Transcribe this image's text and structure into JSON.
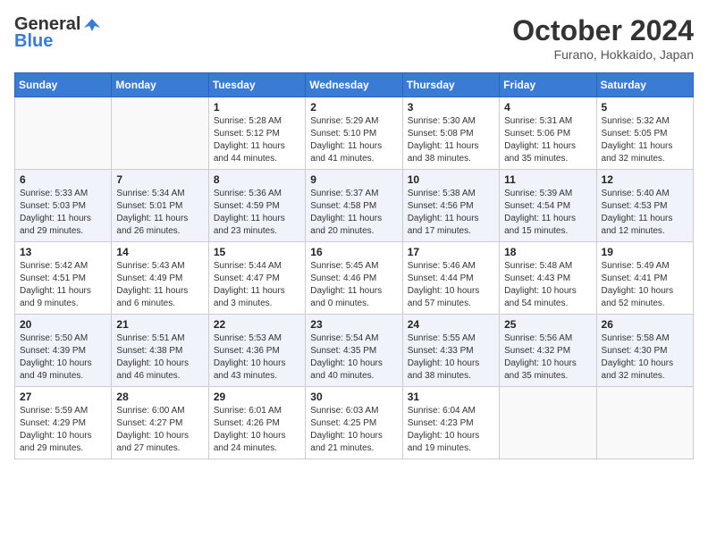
{
  "header": {
    "logo_general": "General",
    "logo_blue": "Blue",
    "month": "October 2024",
    "location": "Furano, Hokkaido, Japan"
  },
  "days_of_week": [
    "Sunday",
    "Monday",
    "Tuesday",
    "Wednesday",
    "Thursday",
    "Friday",
    "Saturday"
  ],
  "weeks": [
    [
      {
        "day": "",
        "lines": []
      },
      {
        "day": "",
        "lines": []
      },
      {
        "day": "1",
        "lines": [
          "Sunrise: 5:28 AM",
          "Sunset: 5:12 PM",
          "Daylight: 11 hours and 44 minutes."
        ]
      },
      {
        "day": "2",
        "lines": [
          "Sunrise: 5:29 AM",
          "Sunset: 5:10 PM",
          "Daylight: 11 hours and 41 minutes."
        ]
      },
      {
        "day": "3",
        "lines": [
          "Sunrise: 5:30 AM",
          "Sunset: 5:08 PM",
          "Daylight: 11 hours and 38 minutes."
        ]
      },
      {
        "day": "4",
        "lines": [
          "Sunrise: 5:31 AM",
          "Sunset: 5:06 PM",
          "Daylight: 11 hours and 35 minutes."
        ]
      },
      {
        "day": "5",
        "lines": [
          "Sunrise: 5:32 AM",
          "Sunset: 5:05 PM",
          "Daylight: 11 hours and 32 minutes."
        ]
      }
    ],
    [
      {
        "day": "6",
        "lines": [
          "Sunrise: 5:33 AM",
          "Sunset: 5:03 PM",
          "Daylight: 11 hours and 29 minutes."
        ]
      },
      {
        "day": "7",
        "lines": [
          "Sunrise: 5:34 AM",
          "Sunset: 5:01 PM",
          "Daylight: 11 hours and 26 minutes."
        ]
      },
      {
        "day": "8",
        "lines": [
          "Sunrise: 5:36 AM",
          "Sunset: 4:59 PM",
          "Daylight: 11 hours and 23 minutes."
        ]
      },
      {
        "day": "9",
        "lines": [
          "Sunrise: 5:37 AM",
          "Sunset: 4:58 PM",
          "Daylight: 11 hours and 20 minutes."
        ]
      },
      {
        "day": "10",
        "lines": [
          "Sunrise: 5:38 AM",
          "Sunset: 4:56 PM",
          "Daylight: 11 hours and 17 minutes."
        ]
      },
      {
        "day": "11",
        "lines": [
          "Sunrise: 5:39 AM",
          "Sunset: 4:54 PM",
          "Daylight: 11 hours and 15 minutes."
        ]
      },
      {
        "day": "12",
        "lines": [
          "Sunrise: 5:40 AM",
          "Sunset: 4:53 PM",
          "Daylight: 11 hours and 12 minutes."
        ]
      }
    ],
    [
      {
        "day": "13",
        "lines": [
          "Sunrise: 5:42 AM",
          "Sunset: 4:51 PM",
          "Daylight: 11 hours and 9 minutes."
        ]
      },
      {
        "day": "14",
        "lines": [
          "Sunrise: 5:43 AM",
          "Sunset: 4:49 PM",
          "Daylight: 11 hours and 6 minutes."
        ]
      },
      {
        "day": "15",
        "lines": [
          "Sunrise: 5:44 AM",
          "Sunset: 4:47 PM",
          "Daylight: 11 hours and 3 minutes."
        ]
      },
      {
        "day": "16",
        "lines": [
          "Sunrise: 5:45 AM",
          "Sunset: 4:46 PM",
          "Daylight: 11 hours and 0 minutes."
        ]
      },
      {
        "day": "17",
        "lines": [
          "Sunrise: 5:46 AM",
          "Sunset: 4:44 PM",
          "Daylight: 10 hours and 57 minutes."
        ]
      },
      {
        "day": "18",
        "lines": [
          "Sunrise: 5:48 AM",
          "Sunset: 4:43 PM",
          "Daylight: 10 hours and 54 minutes."
        ]
      },
      {
        "day": "19",
        "lines": [
          "Sunrise: 5:49 AM",
          "Sunset: 4:41 PM",
          "Daylight: 10 hours and 52 minutes."
        ]
      }
    ],
    [
      {
        "day": "20",
        "lines": [
          "Sunrise: 5:50 AM",
          "Sunset: 4:39 PM",
          "Daylight: 10 hours and 49 minutes."
        ]
      },
      {
        "day": "21",
        "lines": [
          "Sunrise: 5:51 AM",
          "Sunset: 4:38 PM",
          "Daylight: 10 hours and 46 minutes."
        ]
      },
      {
        "day": "22",
        "lines": [
          "Sunrise: 5:53 AM",
          "Sunset: 4:36 PM",
          "Daylight: 10 hours and 43 minutes."
        ]
      },
      {
        "day": "23",
        "lines": [
          "Sunrise: 5:54 AM",
          "Sunset: 4:35 PM",
          "Daylight: 10 hours and 40 minutes."
        ]
      },
      {
        "day": "24",
        "lines": [
          "Sunrise: 5:55 AM",
          "Sunset: 4:33 PM",
          "Daylight: 10 hours and 38 minutes."
        ]
      },
      {
        "day": "25",
        "lines": [
          "Sunrise: 5:56 AM",
          "Sunset: 4:32 PM",
          "Daylight: 10 hours and 35 minutes."
        ]
      },
      {
        "day": "26",
        "lines": [
          "Sunrise: 5:58 AM",
          "Sunset: 4:30 PM",
          "Daylight: 10 hours and 32 minutes."
        ]
      }
    ],
    [
      {
        "day": "27",
        "lines": [
          "Sunrise: 5:59 AM",
          "Sunset: 4:29 PM",
          "Daylight: 10 hours and 29 minutes."
        ]
      },
      {
        "day": "28",
        "lines": [
          "Sunrise: 6:00 AM",
          "Sunset: 4:27 PM",
          "Daylight: 10 hours and 27 minutes."
        ]
      },
      {
        "day": "29",
        "lines": [
          "Sunrise: 6:01 AM",
          "Sunset: 4:26 PM",
          "Daylight: 10 hours and 24 minutes."
        ]
      },
      {
        "day": "30",
        "lines": [
          "Sunrise: 6:03 AM",
          "Sunset: 4:25 PM",
          "Daylight: 10 hours and 21 minutes."
        ]
      },
      {
        "day": "31",
        "lines": [
          "Sunrise: 6:04 AM",
          "Sunset: 4:23 PM",
          "Daylight: 10 hours and 19 minutes."
        ]
      },
      {
        "day": "",
        "lines": []
      },
      {
        "day": "",
        "lines": []
      }
    ]
  ]
}
